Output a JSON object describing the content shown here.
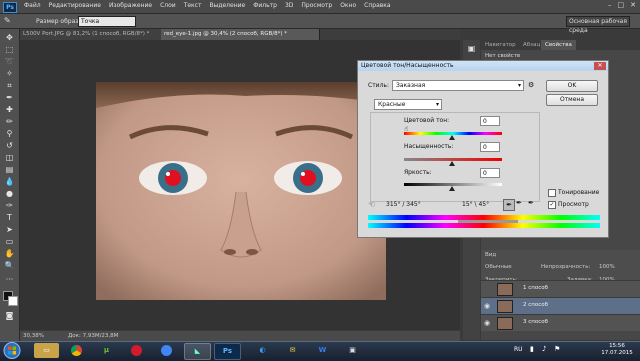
{
  "menubar": {
    "logo": "Ps",
    "items": [
      "Файл",
      "Редактирование",
      "Изображение",
      "Слои",
      "Текст",
      "Выделение",
      "Фильтр",
      "3D",
      "Просмотр",
      "Окно",
      "Справка"
    ]
  },
  "optionsbar": {
    "sample_size_label": "Размер образца:",
    "sample_size_value": "Точка",
    "workspace": "Основная рабочая среда"
  },
  "tabs": [
    {
      "label": "L500V Port.JPG @ 81,2% (1 способ, RGB/8*) *",
      "active": false
    },
    {
      "label": "red_eye-1.jpg @ 30,4% (2 способ, RGB/8*) *",
      "active": true
    }
  ],
  "status": {
    "zoom": "30,38%",
    "doc": "Док: 7,93M/23,8M"
  },
  "right_panel": {
    "tabs": [
      "Навигатор",
      "Абзац",
      "Свойства"
    ],
    "active_tab": "Свойства",
    "no_props": "Нет свойств",
    "layers_labels": {
      "kind": "Вид",
      "blend": "Обычные",
      "opacity_label": "Непрозрачность:",
      "opacity_value": "100%",
      "lock_label": "Закрепить:",
      "fill_label": "Заливка:",
      "fill_value": "100%"
    },
    "layers": [
      {
        "name": "1 способ",
        "selected": false
      },
      {
        "name": "2 способ",
        "selected": true
      },
      {
        "name": "3 способ",
        "selected": false
      }
    ]
  },
  "dialog": {
    "title": "Цветовой тон/Насыщенность",
    "style_label": "Стиль:",
    "style_value": "Заказная",
    "channel_value": "Красные",
    "hue_label": "Цветовой тон:",
    "hue_value": "0",
    "saturation_label": "Насыщенность:",
    "saturation_value": "0",
    "lightness_label": "Яркость:",
    "lightness_value": "0",
    "range_left": "315° / 345°",
    "range_right": "15° \\ 45°",
    "ok": "OK",
    "cancel": "Отмена",
    "colorize_label": "Тонирование",
    "colorize_checked": false,
    "preview_label": "Просмотр",
    "preview_checked": true
  },
  "taskbar": {
    "apps": [
      "folder",
      "chrome",
      "utorrent",
      "media",
      "chromium",
      "photoshop",
      "explorer",
      "mail",
      "word",
      "terminal"
    ],
    "lang": "RU",
    "time": "15:56",
    "date": "17.07.2015"
  }
}
